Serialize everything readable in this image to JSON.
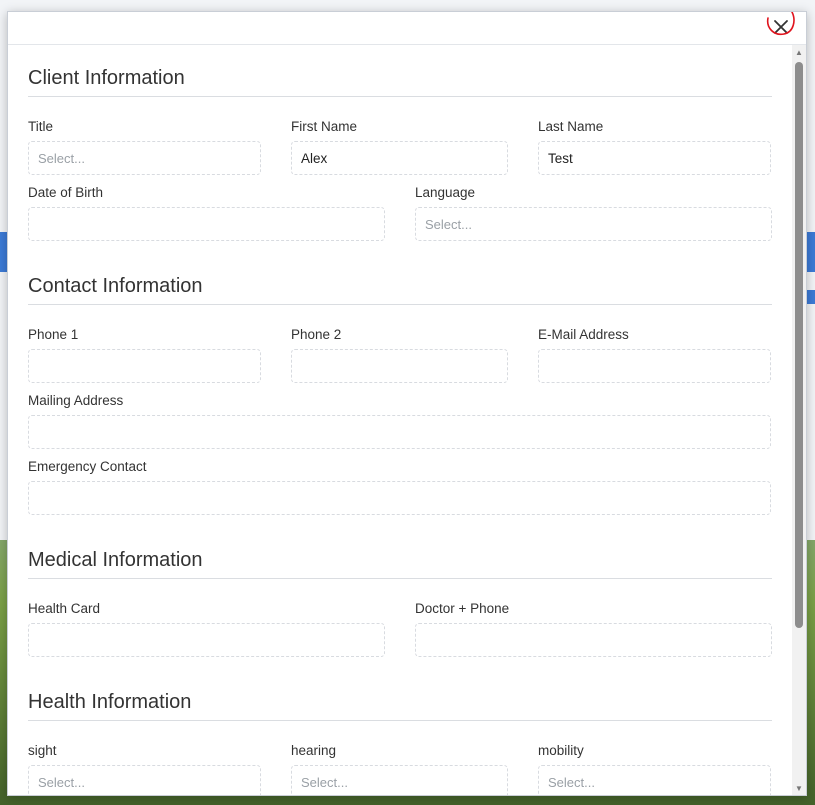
{
  "modal": {
    "close_icon": "close-icon"
  },
  "sections": {
    "client": {
      "title": "Client Information",
      "title_label": "Title",
      "title_placeholder": "Select...",
      "first_name_label": "First Name",
      "first_name_value": "Alex",
      "last_name_label": "Last Name",
      "last_name_value": "Test",
      "dob_label": "Date of Birth",
      "dob_value": "",
      "language_label": "Language",
      "language_placeholder": "Select..."
    },
    "contact": {
      "title": "Contact Information",
      "phone1_label": "Phone 1",
      "phone1_value": "",
      "phone2_label": "Phone 2",
      "phone2_value": "",
      "email_label": "E-Mail Address",
      "email_value": "",
      "mailing_label": "Mailing Address",
      "mailing_value": "",
      "emergency_label": "Emergency Contact",
      "emergency_value": ""
    },
    "medical": {
      "title": "Medical Information",
      "health_card_label": "Health Card",
      "health_card_value": "",
      "doctor_label": "Doctor + Phone",
      "doctor_value": ""
    },
    "health": {
      "title": "Health Information",
      "sight_label": "sight",
      "sight_placeholder": "Select...",
      "hearing_label": "hearing",
      "hearing_placeholder": "Select...",
      "mobility_label": "mobility",
      "mobility_placeholder": "Select..."
    }
  },
  "colors": {
    "annotation": "#e0141e",
    "scroll_thumb": "#8d8d8d"
  }
}
